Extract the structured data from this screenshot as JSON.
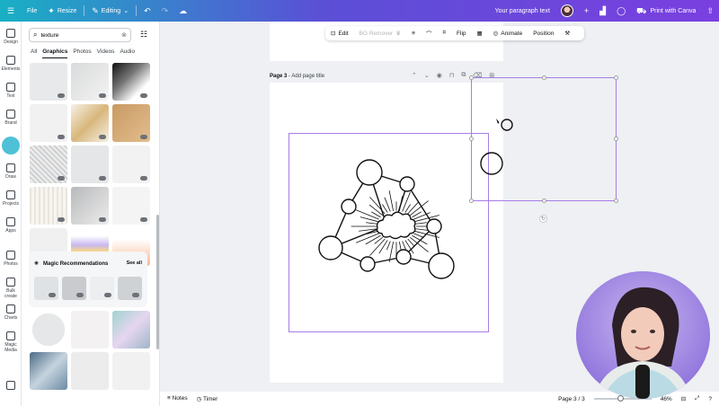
{
  "topbar": {
    "file": "File",
    "resize": "Resize",
    "editing": "Editing",
    "doc_title": "Your paragraph text",
    "print_label": "Print with Canva"
  },
  "rail": [
    {
      "label": "Design",
      "icon": "design-icon"
    },
    {
      "label": "Elements",
      "icon": "elements-icon"
    },
    {
      "label": "Text",
      "icon": "text-icon"
    },
    {
      "label": "Brand",
      "icon": "brand-icon"
    },
    {
      "label": "",
      "icon": "uploads-icon"
    },
    {
      "label": "Draw",
      "icon": "draw-icon"
    },
    {
      "label": "Projects",
      "icon": "projects-icon"
    },
    {
      "label": "Apps",
      "icon": "apps-icon"
    },
    {
      "label": "Photos",
      "icon": "photos-icon"
    },
    {
      "label": "Bulk create",
      "icon": "bulk-create-icon"
    },
    {
      "label": "Charts",
      "icon": "charts-icon"
    },
    {
      "label": "Magic Media",
      "icon": "magic-media-icon"
    },
    {
      "label": "",
      "icon": "magic-icon"
    }
  ],
  "panel": {
    "search_value": "texture",
    "tabs": [
      "All",
      "Graphics",
      "Photos",
      "Videos",
      "Audio"
    ],
    "active_tab": "Graphics",
    "magic_title": "Magic Recommendations",
    "see_all": "See all"
  },
  "context_toolbar": {
    "edit": "Edit",
    "bg_remover": "BG Remover",
    "flip": "Flip",
    "animate": "Animate",
    "position": "Position"
  },
  "page": {
    "label": "Page 3",
    "title_placeholder": "Add page title"
  },
  "bottombar": {
    "notes": "Notes",
    "timer": "Timer",
    "page_indicator": "Page 3 / 3",
    "zoom": "46%",
    "zoom_fraction": 0.46
  },
  "colors": {
    "selection": "#a67de8",
    "accent": "#4fc1d6"
  }
}
